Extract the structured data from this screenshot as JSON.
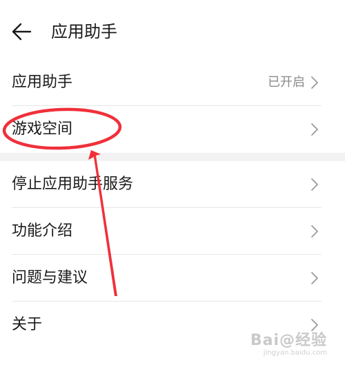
{
  "header": {
    "title": "应用助手"
  },
  "groups": [
    {
      "items": [
        {
          "label": "应用助手",
          "value": "已开启"
        },
        {
          "label": "游戏空间",
          "value": ""
        }
      ]
    },
    {
      "items": [
        {
          "label": "停止应用助手服务"
        },
        {
          "label": "功能介绍"
        },
        {
          "label": "问题与建议"
        },
        {
          "label": "关于"
        }
      ]
    }
  ],
  "watermark": {
    "logo": "Bai@经验",
    "sub": "jingyan.baidu.com"
  },
  "colors": {
    "annotation": "#f0303a",
    "text": "#1a1a1a",
    "secondary": "#8a8a8a",
    "separator": "#e6e6e6",
    "band": "#f2f2f2"
  },
  "icons": {
    "back": "arrow-left-icon",
    "chevron": "chevron-right-icon"
  }
}
